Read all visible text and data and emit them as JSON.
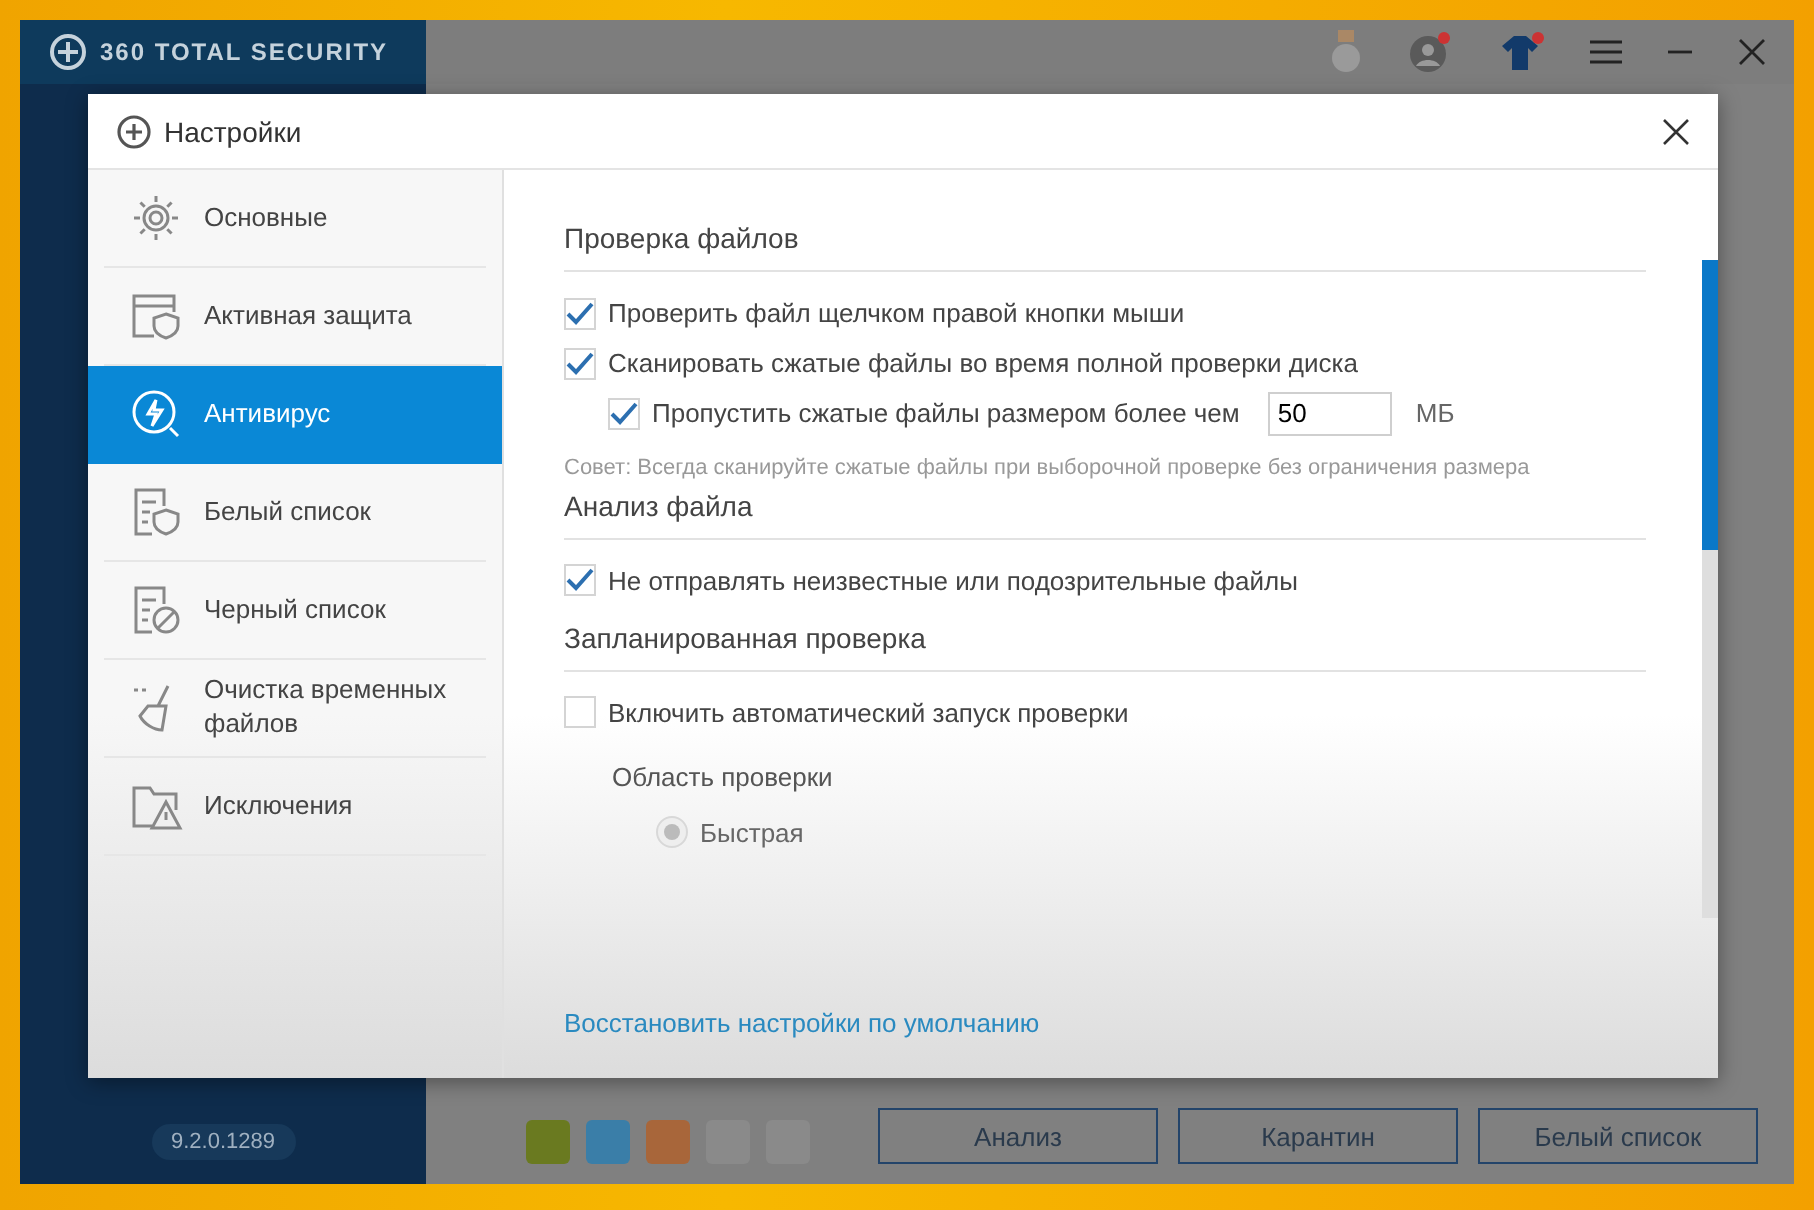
{
  "app": {
    "title": "360 TOTAL SECURITY",
    "version": "9.2.0.1289",
    "bottom_buttons": [
      "Анализ",
      "Карантин",
      "Белый список"
    ]
  },
  "dialog": {
    "title": "Настройки",
    "nav": [
      {
        "label": "Основные",
        "selected": false
      },
      {
        "label": "Активная защита",
        "selected": false
      },
      {
        "label": "Антивирус",
        "selected": true
      },
      {
        "label": "Белый список",
        "selected": false
      },
      {
        "label": "Черный список",
        "selected": false
      },
      {
        "label": "Очистка временных файлов",
        "selected": false
      },
      {
        "label": "Исключения",
        "selected": false
      }
    ],
    "sections": [
      {
        "heading": "Проверка файлов",
        "items": [
          {
            "kind": "checkbox",
            "label": "Проверить файл щелчком правой кнопки мыши",
            "checked": true
          },
          {
            "kind": "checkbox",
            "label": "Сканировать сжатые файлы во время полной проверки диска",
            "checked": true,
            "children": [
              {
                "kind": "checkbox",
                "label": "Пропустить сжатые файлы размером более чем",
                "checked": true,
                "value": "50",
                "unit": "МБ"
              }
            ]
          },
          {
            "kind": "note",
            "label": "Совет: Всегда сканируйте сжатые файлы при выборочной проверке без ограничения размера"
          }
        ]
      },
      {
        "heading": "Анализ файла",
        "items": [
          {
            "kind": "checkbox",
            "label": "Не отправлять неизвестные или подозрительные файлы",
            "checked": true
          }
        ]
      },
      {
        "heading": "Запланированная проверка",
        "items": [
          {
            "kind": "checkbox",
            "label": "Включить автоматический запуск проверки",
            "checked": false
          },
          {
            "kind": "group",
            "label": "Область проверки",
            "children": [
              {
                "kind": "radio",
                "label": "Быстрая",
                "selected": true,
                "disabled": true
              }
            ]
          }
        ]
      }
    ],
    "reset_link": "Восстановить настройки по умолчанию"
  }
}
